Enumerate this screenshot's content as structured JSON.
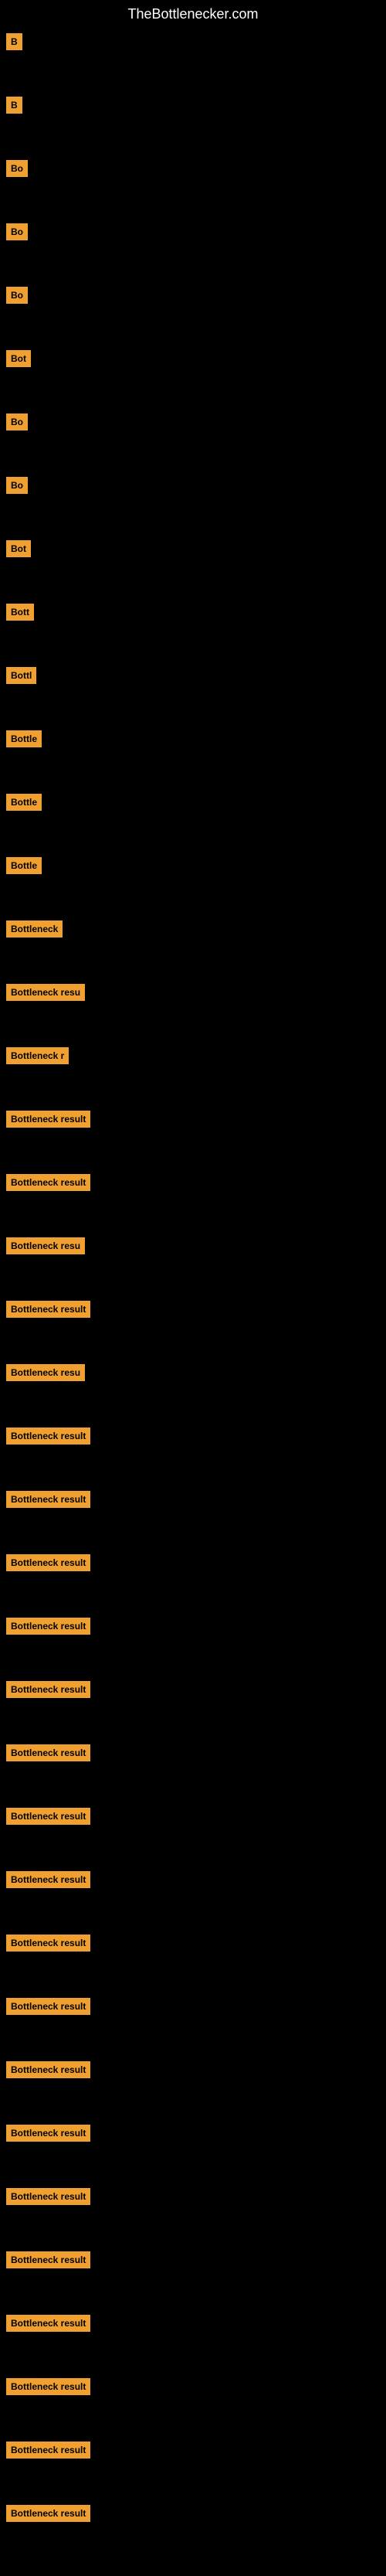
{
  "site": {
    "title": "TheBottlenecker.com"
  },
  "items": [
    {
      "id": 1,
      "label": "B"
    },
    {
      "id": 2,
      "label": "B"
    },
    {
      "id": 3,
      "label": "Bo"
    },
    {
      "id": 4,
      "label": "Bo"
    },
    {
      "id": 5,
      "label": "Bo"
    },
    {
      "id": 6,
      "label": "Bot"
    },
    {
      "id": 7,
      "label": "Bo"
    },
    {
      "id": 8,
      "label": "Bo"
    },
    {
      "id": 9,
      "label": "Bot"
    },
    {
      "id": 10,
      "label": "Bott"
    },
    {
      "id": 11,
      "label": "Bottl"
    },
    {
      "id": 12,
      "label": "Bottle"
    },
    {
      "id": 13,
      "label": "Bottle"
    },
    {
      "id": 14,
      "label": "Bottle"
    },
    {
      "id": 15,
      "label": "Bottleneck"
    },
    {
      "id": 16,
      "label": "Bottleneck resu"
    },
    {
      "id": 17,
      "label": "Bottleneck r"
    },
    {
      "id": 18,
      "label": "Bottleneck result"
    },
    {
      "id": 19,
      "label": "Bottleneck result"
    },
    {
      "id": 20,
      "label": "Bottleneck resu"
    },
    {
      "id": 21,
      "label": "Bottleneck result"
    },
    {
      "id": 22,
      "label": "Bottleneck resu"
    },
    {
      "id": 23,
      "label": "Bottleneck result"
    },
    {
      "id": 24,
      "label": "Bottleneck result"
    },
    {
      "id": 25,
      "label": "Bottleneck result"
    },
    {
      "id": 26,
      "label": "Bottleneck result"
    },
    {
      "id": 27,
      "label": "Bottleneck result"
    },
    {
      "id": 28,
      "label": "Bottleneck result"
    },
    {
      "id": 29,
      "label": "Bottleneck result"
    },
    {
      "id": 30,
      "label": "Bottleneck result"
    },
    {
      "id": 31,
      "label": "Bottleneck result"
    },
    {
      "id": 32,
      "label": "Bottleneck result"
    },
    {
      "id": 33,
      "label": "Bottleneck result"
    },
    {
      "id": 34,
      "label": "Bottleneck result"
    },
    {
      "id": 35,
      "label": "Bottleneck result"
    },
    {
      "id": 36,
      "label": "Bottleneck result"
    },
    {
      "id": 37,
      "label": "Bottleneck result"
    },
    {
      "id": 38,
      "label": "Bottleneck result"
    },
    {
      "id": 39,
      "label": "Bottleneck result"
    },
    {
      "id": 40,
      "label": "Bottleneck result"
    }
  ]
}
